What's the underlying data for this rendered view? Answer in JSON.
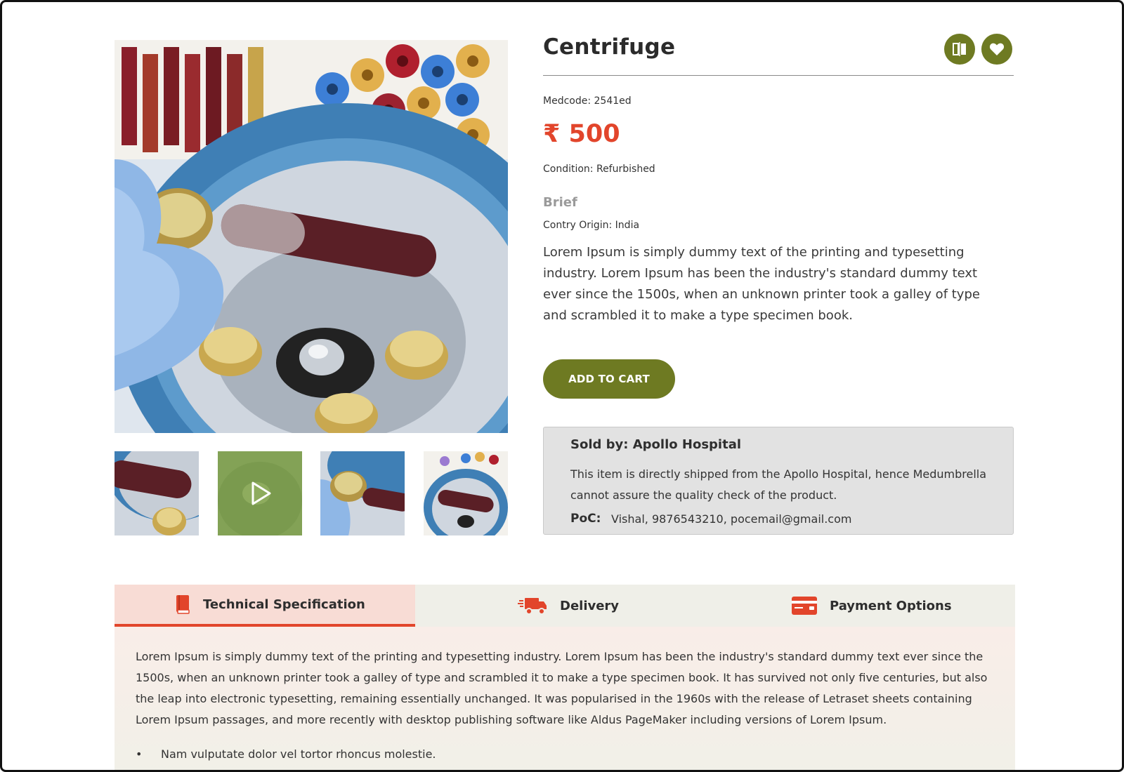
{
  "gallery": {
    "main_image_alt": "centrifuge-photo",
    "thumbnails": [
      {
        "name": "thumb-tube-closeup",
        "type": "image"
      },
      {
        "name": "thumb-video",
        "type": "video"
      },
      {
        "name": "thumb-glove",
        "type": "image"
      },
      {
        "name": "thumb-overview",
        "type": "image"
      }
    ]
  },
  "product": {
    "title": "Centrifuge",
    "medcode": "Medcode: 2541ed",
    "price": "₹ 500",
    "condition": "Condition: Refurbished",
    "brief_heading": "Brief",
    "origin": "Contry Origin: India",
    "description": "Lorem Ipsum is simply dummy text of the printing and typesetting industry. Lorem Ipsum has been the industry's standard dummy text ever since the 1500s, when an unknown printer took a galley of type and scrambled it to make a type specimen book.",
    "add_to_cart": "ADD TO CART"
  },
  "seller": {
    "sold_by": "Sold by: Apollo Hospital",
    "note": "This item is directly shipped from the Apollo Hospital, hence Medumbrella cannot assure the quality check of the product.",
    "poc_label": "PoC:",
    "poc_value": "Vishal, 9876543210, pocemail@gmail.com"
  },
  "tabs": [
    {
      "label": "Technical Specification",
      "icon": "book-icon",
      "active": true
    },
    {
      "label": "Delivery",
      "icon": "truck-icon",
      "active": false
    },
    {
      "label": "Payment Options",
      "icon": "credit-card-icon",
      "active": false
    }
  ],
  "tab_content": {
    "text": "Lorem Ipsum is simply dummy text of the printing and typesetting industry. Lorem Ipsum has been the industry's standard dummy text ever since the 1500s, when an unknown printer took a galley of type and scrambled it to make a type specimen book. It has survived not only five centuries, but also the leap into electronic typesetting, remaining essentially unchanged. It was popularised in the 1960s with the release of Letraset sheets containing Lorem Ipsum passages, and more recently with desktop publishing software like Aldus PageMaker including versions of Lorem Ipsum.",
    "bullets": [
      "Nam vulputate dolor vel tortor rhoncus molestie."
    ]
  },
  "colors": {
    "accent_green": "#6e7a22",
    "price_red": "#e2452b",
    "tab_active_bg": "#f8dcd5",
    "seller_box_bg": "#e2e2e2"
  }
}
